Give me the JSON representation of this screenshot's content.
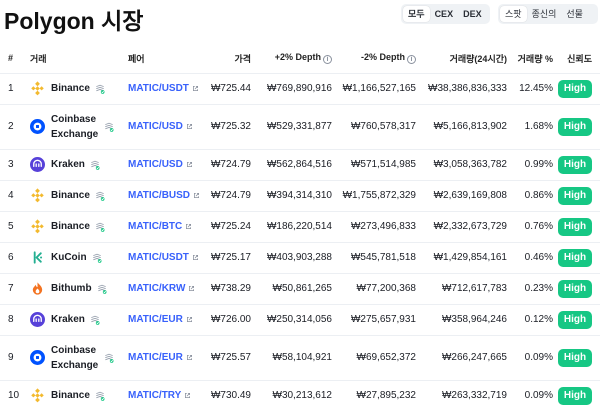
{
  "title": "Polygon 시장",
  "filters": {
    "market_type": [
      "모두",
      "CEX",
      "DEX"
    ],
    "market_active": 0,
    "category": [
      "스팟",
      "종신의",
      "선물"
    ],
    "category_active": 0
  },
  "columns": {
    "rank": "#",
    "exchange": "거래",
    "pair": "페어",
    "price": "가격",
    "depth_plus": "+2% Depth",
    "depth_minus": "-2% Depth",
    "volume": "거래량(24시간)",
    "volume_pct": "거래량 %",
    "trust": "신뢰도"
  },
  "rows": [
    {
      "rank": "1",
      "exchange": "Binance",
      "logo": "binance-logo",
      "pair": "MATIC/USDT",
      "price": "₩725.44",
      "depth_plus": "₩769,890,916",
      "depth_minus": "₩1,166,527,165",
      "volume": "₩38,386,836,333",
      "volume_pct": "12.45%",
      "trust": "High"
    },
    {
      "rank": "2",
      "exchange": "Coinbase Exchange",
      "logo": "coinbase-logo",
      "pair": "MATIC/USD",
      "price": "₩725.32",
      "depth_plus": "₩529,331,877",
      "depth_minus": "₩760,578,317",
      "volume": "₩5,166,813,902",
      "volume_pct": "1.68%",
      "trust": "High"
    },
    {
      "rank": "3",
      "exchange": "Kraken",
      "logo": "kraken-logo",
      "pair": "MATIC/USD",
      "price": "₩724.79",
      "depth_plus": "₩562,864,516",
      "depth_minus": "₩571,514,985",
      "volume": "₩3,058,363,782",
      "volume_pct": "0.99%",
      "trust": "High"
    },
    {
      "rank": "4",
      "exchange": "Binance",
      "logo": "binance-logo",
      "pair": "MATIC/BUSD",
      "price": "₩724.79",
      "depth_plus": "₩394,314,310",
      "depth_minus": "₩1,755,872,329",
      "volume": "₩2,639,169,808",
      "volume_pct": "0.86%",
      "trust": "High"
    },
    {
      "rank": "5",
      "exchange": "Binance",
      "logo": "binance-logo",
      "pair": "MATIC/BTC",
      "price": "₩725.24",
      "depth_plus": "₩186,220,514",
      "depth_minus": "₩273,496,833",
      "volume": "₩2,332,673,729",
      "volume_pct": "0.76%",
      "trust": "High"
    },
    {
      "rank": "6",
      "exchange": "KuCoin",
      "logo": "kucoin-logo",
      "pair": "MATIC/USDT",
      "price": "₩725.17",
      "depth_plus": "₩403,903,288",
      "depth_minus": "₩545,781,518",
      "volume": "₩1,429,854,161",
      "volume_pct": "0.46%",
      "trust": "High"
    },
    {
      "rank": "7",
      "exchange": "Bithumb",
      "logo": "bithumb-logo",
      "pair": "MATIC/KRW",
      "price": "₩738.29",
      "depth_plus": "₩50,861,265",
      "depth_minus": "₩77,200,368",
      "volume": "₩712,617,783",
      "volume_pct": "0.23%",
      "trust": "High"
    },
    {
      "rank": "8",
      "exchange": "Kraken",
      "logo": "kraken-logo",
      "pair": "MATIC/EUR",
      "price": "₩726.00",
      "depth_plus": "₩250,314,056",
      "depth_minus": "₩275,657,931",
      "volume": "₩358,964,246",
      "volume_pct": "0.12%",
      "trust": "High"
    },
    {
      "rank": "9",
      "exchange": "Coinbase Exchange",
      "logo": "coinbase-logo",
      "pair": "MATIC/EUR",
      "price": "₩725.57",
      "depth_plus": "₩58,104,921",
      "depth_minus": "₩69,652,372",
      "volume": "₩266,247,665",
      "volume_pct": "0.09%",
      "trust": "High"
    },
    {
      "rank": "10",
      "exchange": "Binance",
      "logo": "binance-logo",
      "pair": "MATIC/TRY",
      "price": "₩730.49",
      "depth_plus": "₩30,213,612",
      "depth_minus": "₩27,895,232",
      "volume": "₩263,332,719",
      "volume_pct": "0.09%",
      "trust": "High"
    }
  ],
  "colors": {
    "accent": "#3861fb",
    "trust_high": "#16c784",
    "binance": "#f3ba2f",
    "coinbase": "#0052ff",
    "kraken": "#5741d9",
    "kucoin": "#23af91",
    "bithumb": "#f37321"
  }
}
